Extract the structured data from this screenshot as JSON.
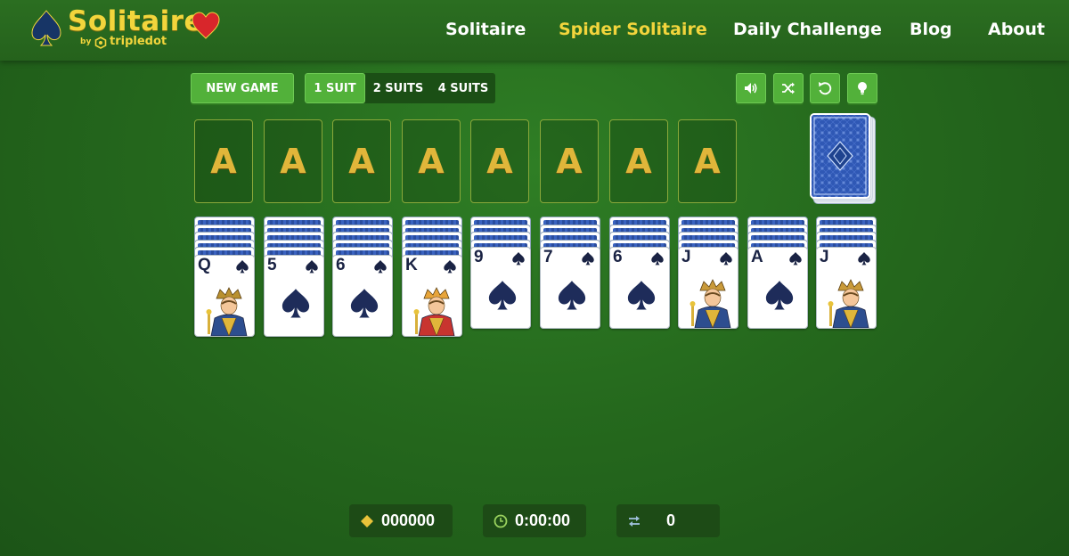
{
  "app": {
    "title": "Solitaire",
    "by": "by",
    "brand": "tripledot"
  },
  "nav": {
    "items": [
      {
        "label": "Solitaire"
      },
      {
        "label": "Spider Solitaire",
        "active": true
      },
      {
        "label": "Daily Challenge"
      },
      {
        "label": "Blog"
      },
      {
        "label": "About"
      }
    ]
  },
  "toolbar": {
    "new_game": "NEW GAME",
    "suit_options": [
      "1 SUIT",
      "2 SUITS",
      "4 SUITS"
    ],
    "selected_suit": "1 SUIT",
    "tools": [
      "sound-icon",
      "shuffle-icon",
      "undo-icon",
      "hint-icon"
    ]
  },
  "foundations": {
    "labels": [
      "A",
      "A",
      "A",
      "A",
      "A",
      "A",
      "A",
      "A"
    ]
  },
  "tableau": {
    "piles": [
      {
        "face_down": 5,
        "top_rank": "Q",
        "suit": "spades",
        "court": "queen"
      },
      {
        "face_down": 5,
        "top_rank": "5",
        "suit": "spades"
      },
      {
        "face_down": 5,
        "top_rank": "6",
        "suit": "spades"
      },
      {
        "face_down": 5,
        "top_rank": "K",
        "suit": "spades",
        "court": "king"
      },
      {
        "face_down": 4,
        "top_rank": "9",
        "suit": "spades"
      },
      {
        "face_down": 4,
        "top_rank": "7",
        "suit": "spades"
      },
      {
        "face_down": 4,
        "top_rank": "6",
        "suit": "spades"
      },
      {
        "face_down": 4,
        "top_rank": "J",
        "suit": "spades",
        "court": "jack"
      },
      {
        "face_down": 4,
        "top_rank": "A",
        "suit": "spades"
      },
      {
        "face_down": 4,
        "top_rank": "J",
        "suit": "spades",
        "court": "jack"
      }
    ]
  },
  "stats": {
    "score": "000000",
    "time": "0:00:00",
    "moves": "0"
  },
  "colors": {
    "felt": "#25691d",
    "accent_gold": "#f2d53c",
    "button_green": "#52b13a",
    "card_ink": "#1a2344"
  }
}
